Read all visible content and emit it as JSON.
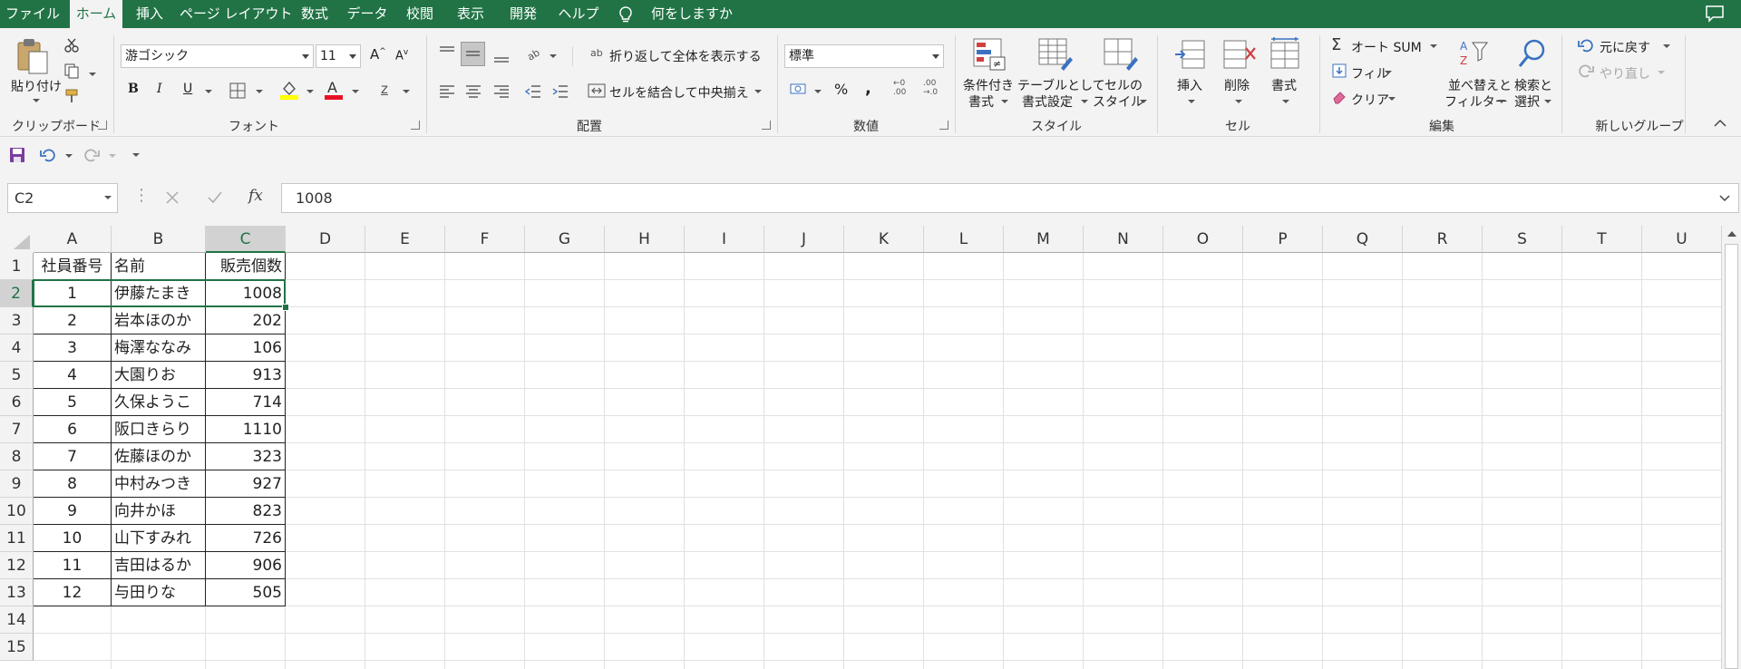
{
  "menu": {
    "tabs": [
      "ファイル",
      "ホーム",
      "挿入",
      "ページ レイアウト",
      "数式",
      "データ",
      "校閲",
      "表示",
      "開発",
      "ヘルプ"
    ],
    "active_tab": "ホーム",
    "tell_me": "何をしますか"
  },
  "ribbon": {
    "clipboard": {
      "paste": "貼り付け",
      "label": "クリップボード"
    },
    "font": {
      "name": "游ゴシック",
      "size": "11",
      "bold": "B",
      "italic": "I",
      "underline": "U",
      "label": "フォント"
    },
    "alignment": {
      "wrap_text": "折り返して全体を表示する",
      "merge_center": "セルを結合して中央揃え",
      "label": "配置"
    },
    "number": {
      "format": "標準",
      "percent": "%",
      "comma": ",",
      "label": "数値"
    },
    "styles": {
      "conditional": "条件付き\n書式",
      "conditional_l1": "条件付き",
      "conditional_l2": "書式",
      "table_l1": "テーブルとして",
      "table_l2": "書式設定",
      "cell_l1": "セルの",
      "cell_l2": "スタイル",
      "label": "スタイル"
    },
    "cells": {
      "insert": "挿入",
      "delete": "削除",
      "format": "書式",
      "label": "セル"
    },
    "editing": {
      "autosum": "オート SUM",
      "fill": "フィル",
      "clear": "クリア",
      "sort_l1": "並べ替えと",
      "sort_l2": "フィルター",
      "find_l1": "検索と",
      "find_l2": "選択",
      "label": "編集"
    },
    "new_group": {
      "undo": "元に戻す",
      "redo": "やり直し",
      "label": "新しいグループ"
    }
  },
  "formula_bar": {
    "name_box": "C2",
    "fx": "fx",
    "value": "1008"
  },
  "grid": {
    "columns": [
      "A",
      "B",
      "C",
      "D",
      "E",
      "F",
      "G",
      "H",
      "I",
      "J",
      "K",
      "L",
      "M",
      "N",
      "O",
      "P",
      "Q",
      "R",
      "S",
      "T",
      "U"
    ],
    "rows": [
      "1",
      "2",
      "3",
      "4",
      "5",
      "6",
      "7",
      "8",
      "9",
      "10",
      "11",
      "12",
      "13",
      "14",
      "15"
    ],
    "selected_cell": "C2",
    "header": [
      "社員番号",
      "名前",
      "販売個数"
    ],
    "data": [
      [
        "1",
        "伊藤たまき",
        "1008"
      ],
      [
        "2",
        "岩本ほのか",
        "202"
      ],
      [
        "3",
        "梅澤ななみ",
        "106"
      ],
      [
        "4",
        "大園りお",
        "913"
      ],
      [
        "5",
        "久保ようこ",
        "714"
      ],
      [
        "6",
        "阪口きらり",
        "1110"
      ],
      [
        "7",
        "佐藤ほのか",
        "323"
      ],
      [
        "8",
        "中村みつき",
        "927"
      ],
      [
        "9",
        "向井かほ",
        "823"
      ],
      [
        "10",
        "山下すみれ",
        "726"
      ],
      [
        "11",
        "吉田はるか",
        "906"
      ],
      [
        "12",
        "与田りな",
        "505"
      ]
    ]
  },
  "colors": {
    "accent": "#217346",
    "font_color": "#e81123",
    "highlight": "#ffff00"
  }
}
